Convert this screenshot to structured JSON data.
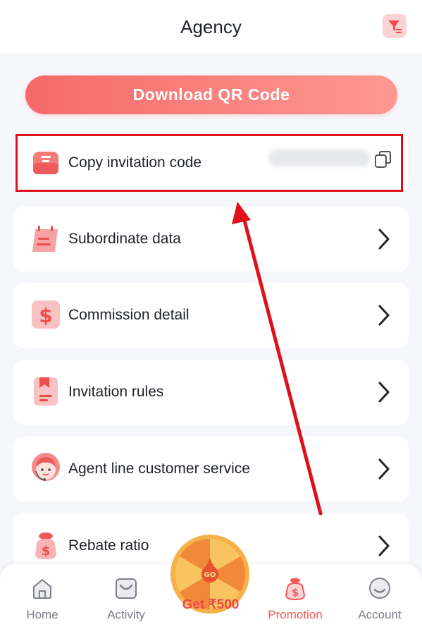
{
  "header": {
    "title": "Agency",
    "filter_icon": "filter-icon"
  },
  "qr_button": {
    "label": "Download QR Code"
  },
  "menu": [
    {
      "label": "Copy invitation code",
      "icon": "inbox-icon",
      "trailing": "copy-icon"
    },
    {
      "label": "Subordinate data",
      "icon": "calendar-icon",
      "trailing": "chevron-right-icon"
    },
    {
      "label": "Commission detail",
      "icon": "dollar-icon",
      "trailing": "chevron-right-icon"
    },
    {
      "label": "Invitation rules",
      "icon": "bookmark-icon",
      "trailing": "chevron-right-icon"
    },
    {
      "label": "Agent line customer service",
      "icon": "headset-agent-icon",
      "trailing": "chevron-right-icon"
    },
    {
      "label": "Rebate ratio",
      "icon": "money-bag-icon",
      "trailing": "chevron-right-icon"
    }
  ],
  "bottom_nav": {
    "items": [
      {
        "label": "Home",
        "icon": "home-icon",
        "active": false
      },
      {
        "label": "Activity",
        "icon": "gift-icon",
        "active": false
      },
      {
        "label": "Promotion",
        "icon": "money-bag-icon",
        "active": true
      },
      {
        "label": "Account",
        "icon": "account-icon",
        "active": false
      }
    ],
    "wheel": {
      "go_text": "GO",
      "label": "Get ₹500"
    }
  },
  "colors": {
    "accent": "#f56a6a",
    "highlight": "#e0101b",
    "active_nav": "#f25a5a"
  }
}
